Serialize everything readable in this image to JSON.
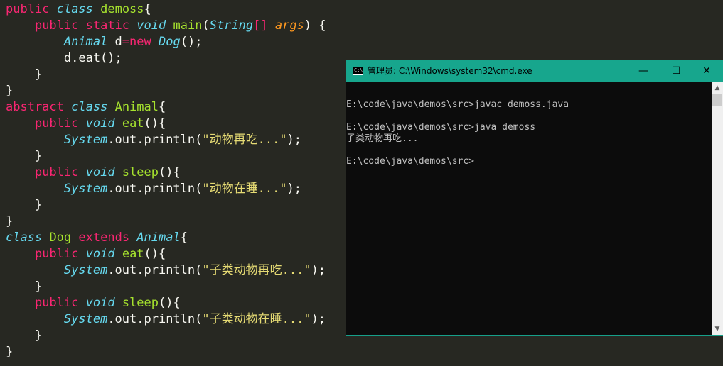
{
  "editor": {
    "lines": [
      [
        [
          "kw",
          "public"
        ],
        [
          "plain",
          " "
        ],
        [
          "kwi",
          "class"
        ],
        [
          "plain",
          " "
        ],
        [
          "cls",
          "demoss"
        ],
        [
          "plain",
          "{"
        ]
      ],
      [
        [
          "plain",
          "    "
        ],
        [
          "kw",
          "public"
        ],
        [
          "plain",
          " "
        ],
        [
          "kw",
          "static"
        ],
        [
          "plain",
          " "
        ],
        [
          "kwi",
          "void"
        ],
        [
          "plain",
          " "
        ],
        [
          "fn",
          "main"
        ],
        [
          "plain",
          "("
        ],
        [
          "type",
          "String"
        ],
        [
          "kw",
          "[]"
        ],
        [
          "plain",
          " "
        ],
        [
          "arg",
          "args"
        ],
        [
          "plain",
          ") {"
        ]
      ],
      [
        [
          "plain",
          "        "
        ],
        [
          "type",
          "Animal"
        ],
        [
          "plain",
          " d"
        ],
        [
          "kw",
          "="
        ],
        [
          "kw",
          "new"
        ],
        [
          "plain",
          " "
        ],
        [
          "type",
          "Dog"
        ],
        [
          "plain",
          "();"
        ]
      ],
      [
        [
          "plain",
          "        d.eat();"
        ]
      ],
      [
        [
          "plain",
          "    }"
        ]
      ],
      [
        [
          "plain",
          "}"
        ]
      ],
      [
        [
          "kw",
          "abstract"
        ],
        [
          "plain",
          " "
        ],
        [
          "kwi",
          "class"
        ],
        [
          "plain",
          " "
        ],
        [
          "cls",
          "Animal"
        ],
        [
          "plain",
          "{"
        ]
      ],
      [
        [
          "plain",
          "    "
        ],
        [
          "kw",
          "public"
        ],
        [
          "plain",
          " "
        ],
        [
          "kwi",
          "void"
        ],
        [
          "plain",
          " "
        ],
        [
          "fn",
          "eat"
        ],
        [
          "plain",
          "(){"
        ]
      ],
      [
        [
          "plain",
          "        "
        ],
        [
          "type",
          "System"
        ],
        [
          "plain",
          ".out.println("
        ],
        [
          "str",
          "\"动物再吃...\""
        ],
        [
          "plain",
          ");"
        ]
      ],
      [
        [
          "plain",
          "    }"
        ]
      ],
      [
        [
          "plain",
          "    "
        ],
        [
          "kw",
          "public"
        ],
        [
          "plain",
          " "
        ],
        [
          "kwi",
          "void"
        ],
        [
          "plain",
          " "
        ],
        [
          "fn",
          "sleep"
        ],
        [
          "plain",
          "(){"
        ]
      ],
      [
        [
          "plain",
          "        "
        ],
        [
          "type",
          "System"
        ],
        [
          "plain",
          ".out.println("
        ],
        [
          "str",
          "\"动物在睡...\""
        ],
        [
          "plain",
          ");"
        ]
      ],
      [
        [
          "plain",
          "    }"
        ]
      ],
      [
        [
          "plain",
          "}"
        ]
      ],
      [
        [
          "kwi",
          "class"
        ],
        [
          "plain",
          " "
        ],
        [
          "cls",
          "Dog"
        ],
        [
          "plain",
          " "
        ],
        [
          "kw",
          "extends"
        ],
        [
          "plain",
          " "
        ],
        [
          "type",
          "Animal"
        ],
        [
          "plain",
          "{"
        ]
      ],
      [
        [
          "plain",
          "    "
        ],
        [
          "kw",
          "public"
        ],
        [
          "plain",
          " "
        ],
        [
          "kwi",
          "void"
        ],
        [
          "plain",
          " "
        ],
        [
          "fn",
          "eat"
        ],
        [
          "plain",
          "(){"
        ]
      ],
      [
        [
          "plain",
          "        "
        ],
        [
          "type",
          "System"
        ],
        [
          "plain",
          ".out.println("
        ],
        [
          "str",
          "\"子类动物再吃...\""
        ],
        [
          "plain",
          ");"
        ]
      ],
      [
        [
          "plain",
          "    }"
        ]
      ],
      [
        [
          "plain",
          "    "
        ],
        [
          "kw",
          "public"
        ],
        [
          "plain",
          " "
        ],
        [
          "kwi",
          "void"
        ],
        [
          "plain",
          " "
        ],
        [
          "fn",
          "sleep"
        ],
        [
          "plain",
          "(){"
        ]
      ],
      [
        [
          "plain",
          "        "
        ],
        [
          "type",
          "System"
        ],
        [
          "plain",
          ".out.println("
        ],
        [
          "str",
          "\"子类动物在睡...\""
        ],
        [
          "plain",
          ");"
        ]
      ],
      [
        [
          "plain",
          "    }"
        ]
      ],
      [
        [
          "plain",
          "}"
        ]
      ]
    ]
  },
  "cmd": {
    "title": "管理员: C:\\Windows\\system32\\cmd.exe",
    "icon_label": "C:\\",
    "minimize_glyph": "—",
    "maximize_glyph": "☐",
    "close_glyph": "✕",
    "scroll_up_glyph": "▲",
    "scroll_down_glyph": "▼",
    "lines": [
      "",
      "E:\\code\\java\\demos\\src>javac demoss.java",
      "",
      "E:\\code\\java\\demos\\src>java demoss",
      "子类动物再吃...",
      "",
      "E:\\code\\java\\demos\\src>"
    ]
  },
  "colors": {
    "editor_bg": "#272822",
    "keyword": "#f92672",
    "type": "#66d9ef",
    "class_name": "#a6e22e",
    "string": "#e6db74",
    "param": "#fd971f",
    "cmd_titlebar": "#17a68d",
    "cmd_bg": "#0c0c0c",
    "cmd_text": "#c0c0c0"
  }
}
